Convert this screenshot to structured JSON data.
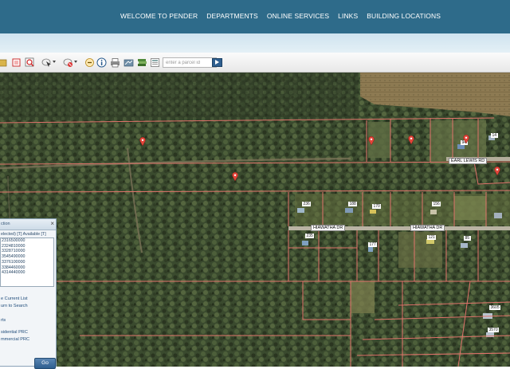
{
  "nav": {
    "items": [
      "WELCOME TO PENDER",
      "DEPARTMENTS",
      "ONLINE SERVICES",
      "LINKS",
      "BUILDING LOCATIONS"
    ]
  },
  "toolbar": {
    "search_placeholder": "enter a parcel id",
    "icons": [
      "folder-icon",
      "layers-icon",
      "search-zoom-icon",
      "select-icon",
      "clear-selection-icon",
      "zoom-out-icon",
      "info-icon",
      "print-icon",
      "measure-icon",
      "layers-stack-icon",
      "export-icon"
    ]
  },
  "map": {
    "road_labels": [
      "EARL LEWIS RD",
      "HIAWATHA DR",
      "HIAWATHA DR"
    ],
    "house_labels": [
      "236",
      "188",
      "170",
      "156",
      "94",
      "14",
      "235",
      "177",
      "121",
      "85",
      "3605",
      "3570"
    ]
  },
  "panel": {
    "title": "ction",
    "subtitle": "elected) [T] Available [T]",
    "parcels": [
      "2316500000",
      "2324810000",
      "3328710000",
      "3545490000",
      "3376100000",
      "3384460000",
      "4314440000"
    ],
    "links": [
      "e Current List",
      "urn to Search",
      "rts",
      "sidential PRC",
      "mmercial PRC"
    ],
    "go_label": "Go"
  },
  "colors": {
    "nav_bg": "#2e6b8a",
    "parcel_line": "#e0736b",
    "pin": "#e2463b"
  }
}
